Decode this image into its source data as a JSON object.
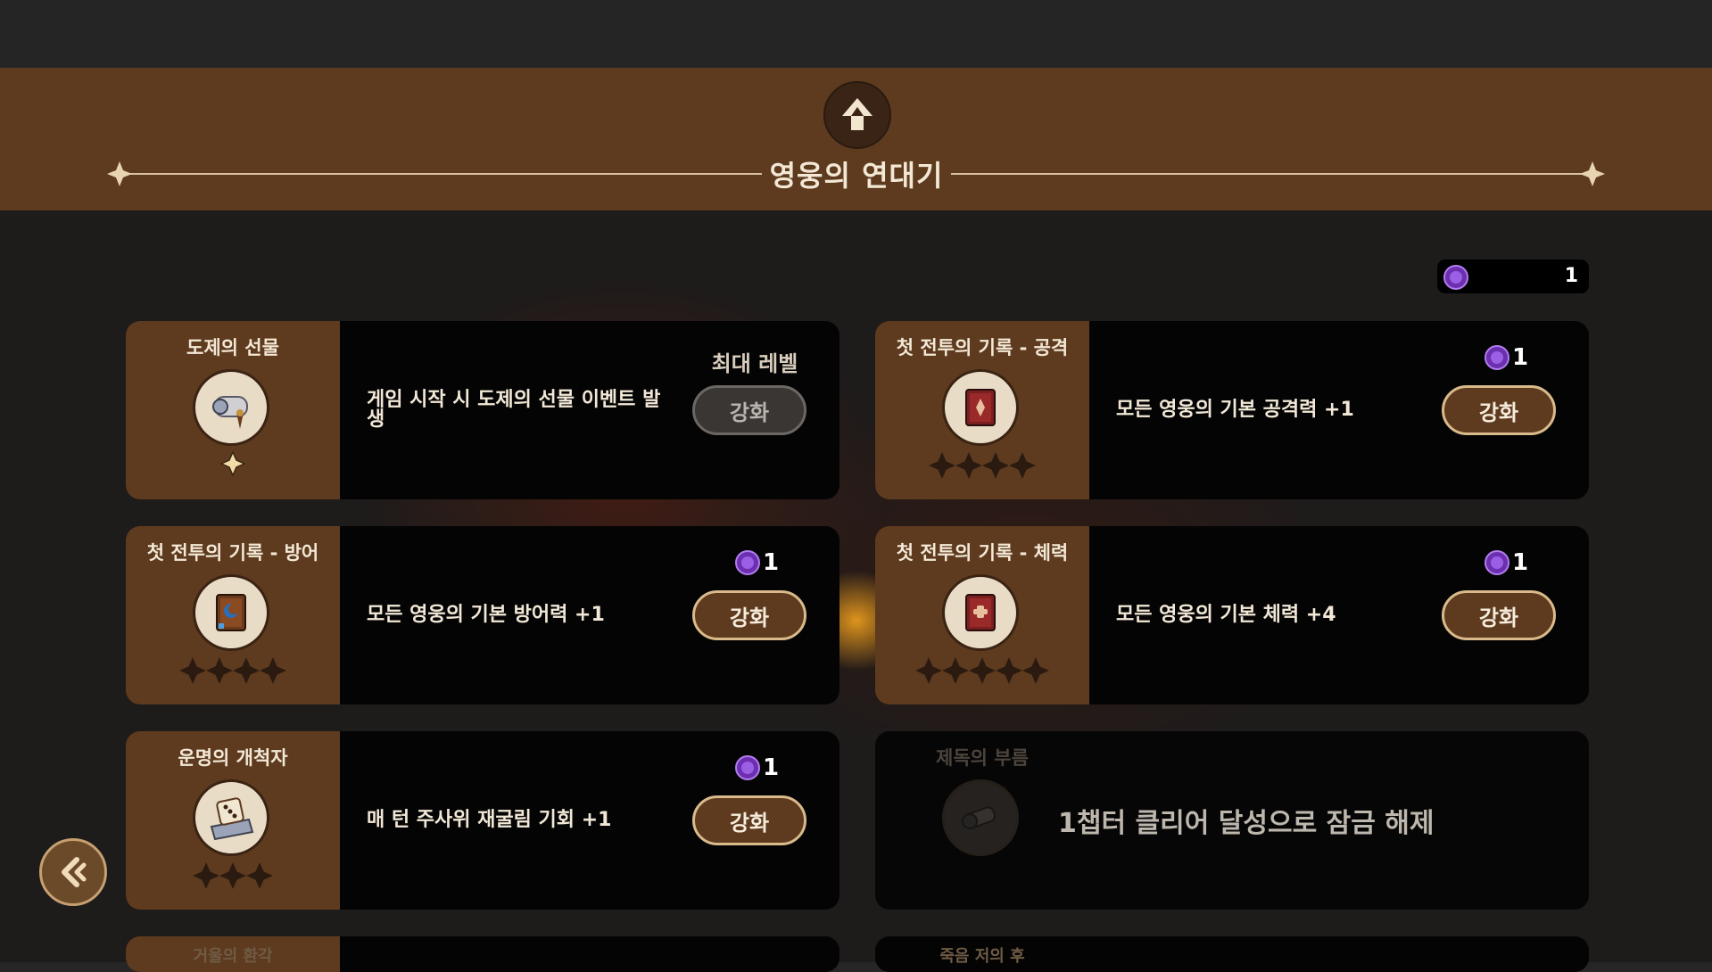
{
  "header": {
    "title": "영웅의 연대기",
    "emblem_icon": "upgrade-arrow-icon"
  },
  "currency": {
    "icon": "purple-gem-icon",
    "amount": "1",
    "color": "#8a4bd6"
  },
  "cards": [
    {
      "name": "도제의 선물",
      "icon": "scroll-icon",
      "stars_total": 1,
      "description": "게임 시작 시 도제의 선물 이벤트 발생",
      "status": "최대 레벨",
      "button": "강화",
      "button_enabled": false
    },
    {
      "name": "첫 전투의 기록 - 공격",
      "icon": "red-book-icon",
      "stars_total": 4,
      "description": "모든 영웅의 기본 공격력 +1",
      "cost": "1",
      "button": "강화",
      "button_enabled": true
    },
    {
      "name": "첫 전투의 기록 - 방어",
      "icon": "blue-book-icon",
      "stars_total": 4,
      "description": "모든 영웅의 기본 방어력 +1",
      "cost": "1",
      "button": "강화",
      "button_enabled": true
    },
    {
      "name": "첫 전투의 기록 - 체력",
      "icon": "red-book-icon",
      "stars_total": 5,
      "description": "모든 영웅의 기본 체력 +4",
      "cost": "1",
      "button": "강화",
      "button_enabled": true
    },
    {
      "name": "운명의 개척자",
      "icon": "dice-map-icon",
      "stars_total": 3,
      "description": "매 턴 주사위 재굴림 기회 +1",
      "cost": "1",
      "button": "강화",
      "button_enabled": true
    },
    {
      "name": "제독의 부름",
      "icon": "spyglass-icon",
      "locked_message": "1챕터 클리어 달성으로 잠금 해제"
    }
  ],
  "peek_cards": [
    {
      "name": "거울의 환각"
    },
    {
      "name": "죽음 저의 후"
    }
  ],
  "back_button_icon": "back-arrow-icon",
  "colors": {
    "panel_brown": "#5e3b1f",
    "button_border": "#d9ba8b",
    "card_bg": "#050404"
  }
}
